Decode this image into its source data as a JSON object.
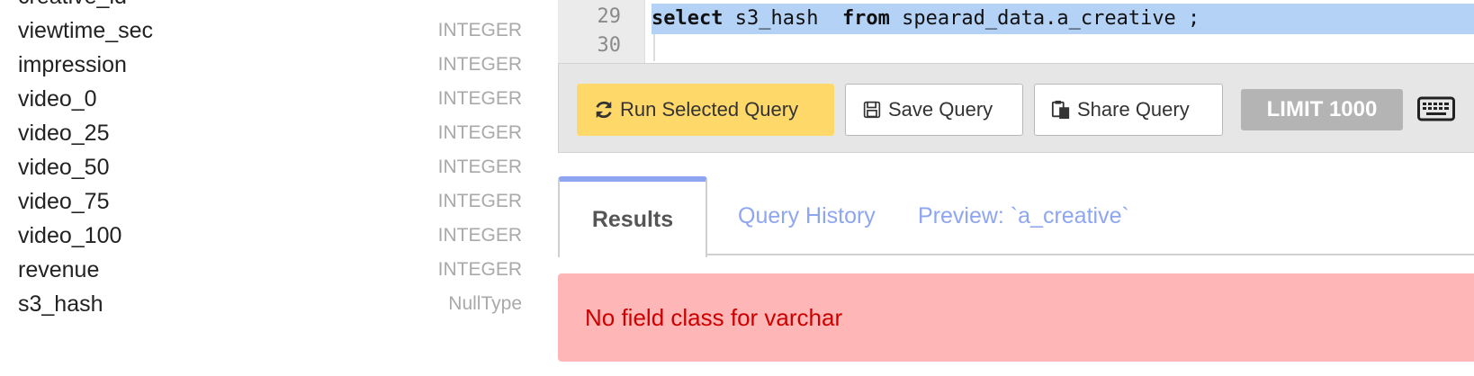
{
  "schema": {
    "columns": [
      {
        "name": "creative_id",
        "type": ""
      },
      {
        "name": "viewtime_sec",
        "type": "INTEGER"
      },
      {
        "name": "impression",
        "type": "INTEGER"
      },
      {
        "name": "video_0",
        "type": "INTEGER"
      },
      {
        "name": "video_25",
        "type": "INTEGER"
      },
      {
        "name": "video_50",
        "type": "INTEGER"
      },
      {
        "name": "video_75",
        "type": "INTEGER"
      },
      {
        "name": "video_100",
        "type": "INTEGER"
      },
      {
        "name": "revenue",
        "type": "INTEGER"
      },
      {
        "name": "s3_hash",
        "type": "NullType"
      }
    ]
  },
  "editor": {
    "lines": [
      {
        "number": "29",
        "keyword1": "select",
        "middle": " s3_hash  ",
        "keyword2": "from",
        "rest": " spearad_data.a_creative ;"
      },
      {
        "number": "30",
        "keyword1": "",
        "middle": "",
        "keyword2": "",
        "rest": ""
      }
    ]
  },
  "toolbar": {
    "run_label": "Run Selected Query",
    "save_label": "Save Query",
    "share_label": "Share Query",
    "limit_label": "LIMIT 1000"
  },
  "tabs": {
    "results": "Results",
    "history": "Query History",
    "preview": "Preview: `a_creative`"
  },
  "error": {
    "message": "No field class for varchar"
  },
  "colors": {
    "run_button": "#ffd86a",
    "tab_accent": "#8ea6f1",
    "error_background": "#ffb6b6",
    "error_text": "#cc0000",
    "selection": "#b4d1f6"
  },
  "icons": {
    "run": "refresh-icon",
    "save": "floppy-disk-icon",
    "share": "clipboard-copy-icon",
    "keyboard": "keyboard-icon"
  }
}
